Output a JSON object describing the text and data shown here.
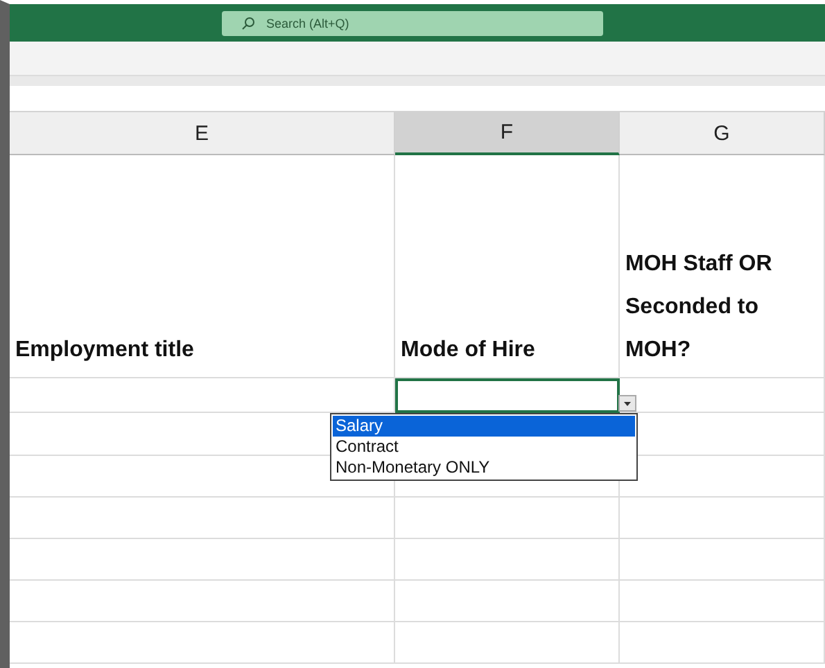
{
  "search": {
    "placeholder": "Search (Alt+Q)"
  },
  "columns": [
    {
      "label": "E",
      "selected": false
    },
    {
      "label": "F",
      "selected": true
    },
    {
      "label": "G",
      "selected": false
    }
  ],
  "header_row": [
    "Employment title",
    "Mode of Hire",
    "MOH Staff OR Seconded to MOH?"
  ],
  "dropdown": {
    "options": [
      {
        "label": "Salary",
        "selected": true
      },
      {
        "label": "Contract",
        "selected": false
      },
      {
        "label": "Non-Monetary ONLY",
        "selected": false
      }
    ]
  }
}
